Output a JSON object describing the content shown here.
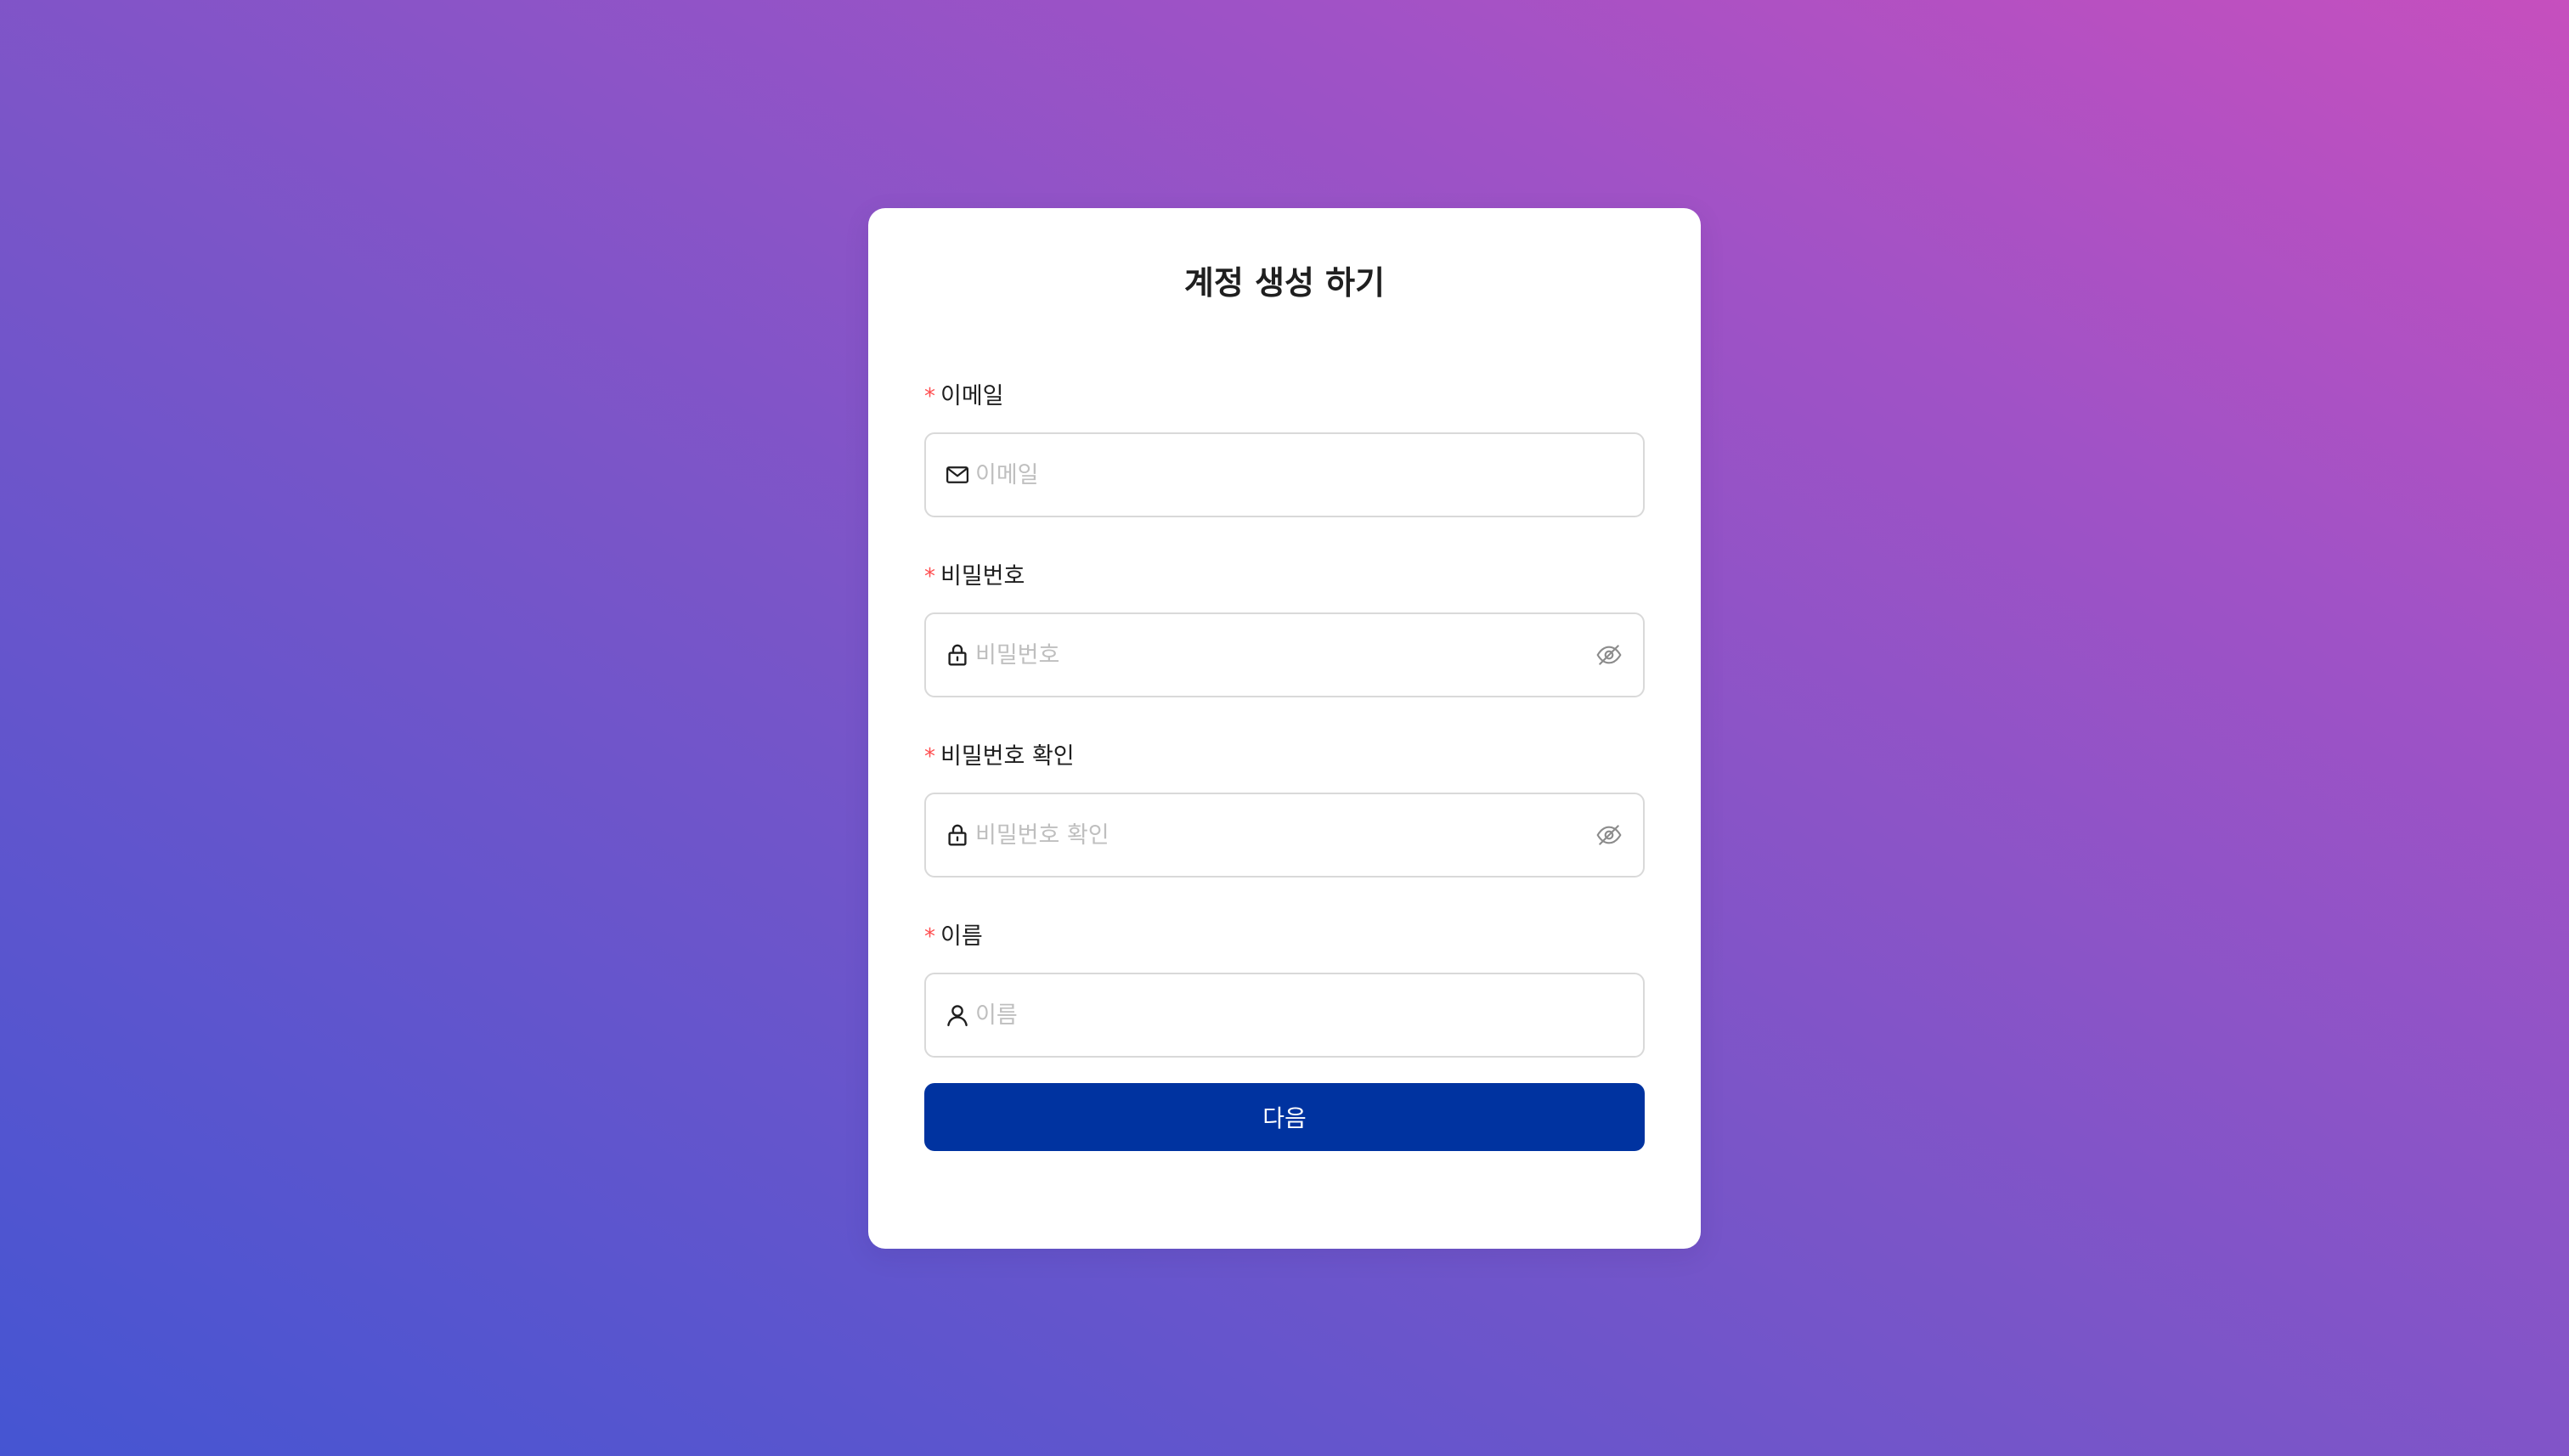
{
  "form": {
    "title": "계정 생성 하기",
    "required_mark": "*",
    "fields": [
      {
        "label": "이메일",
        "placeholder": "이메일",
        "value": "",
        "prefix_icon": "mail-icon"
      },
      {
        "label": "비밀번호",
        "placeholder": "비밀번호",
        "value": "",
        "prefix_icon": "lock-icon",
        "suffix_icon": "eye-invisible-icon"
      },
      {
        "label": "비밀번호 확인",
        "placeholder": "비밀번호 확인",
        "value": "",
        "prefix_icon": "lock-icon",
        "suffix_icon": "eye-invisible-icon"
      },
      {
        "label": "이름",
        "placeholder": "이름",
        "value": "",
        "prefix_icon": "user-icon"
      }
    ],
    "submit_label": "다음"
  },
  "colors": {
    "primary_button": "#0033a0",
    "required_mark": "#ff4d4f",
    "placeholder": "#bfbfbf",
    "input_border": "#d9d9d9",
    "background_gradient_start": "#4555d2",
    "background_gradient_end": "#c64fbe"
  }
}
